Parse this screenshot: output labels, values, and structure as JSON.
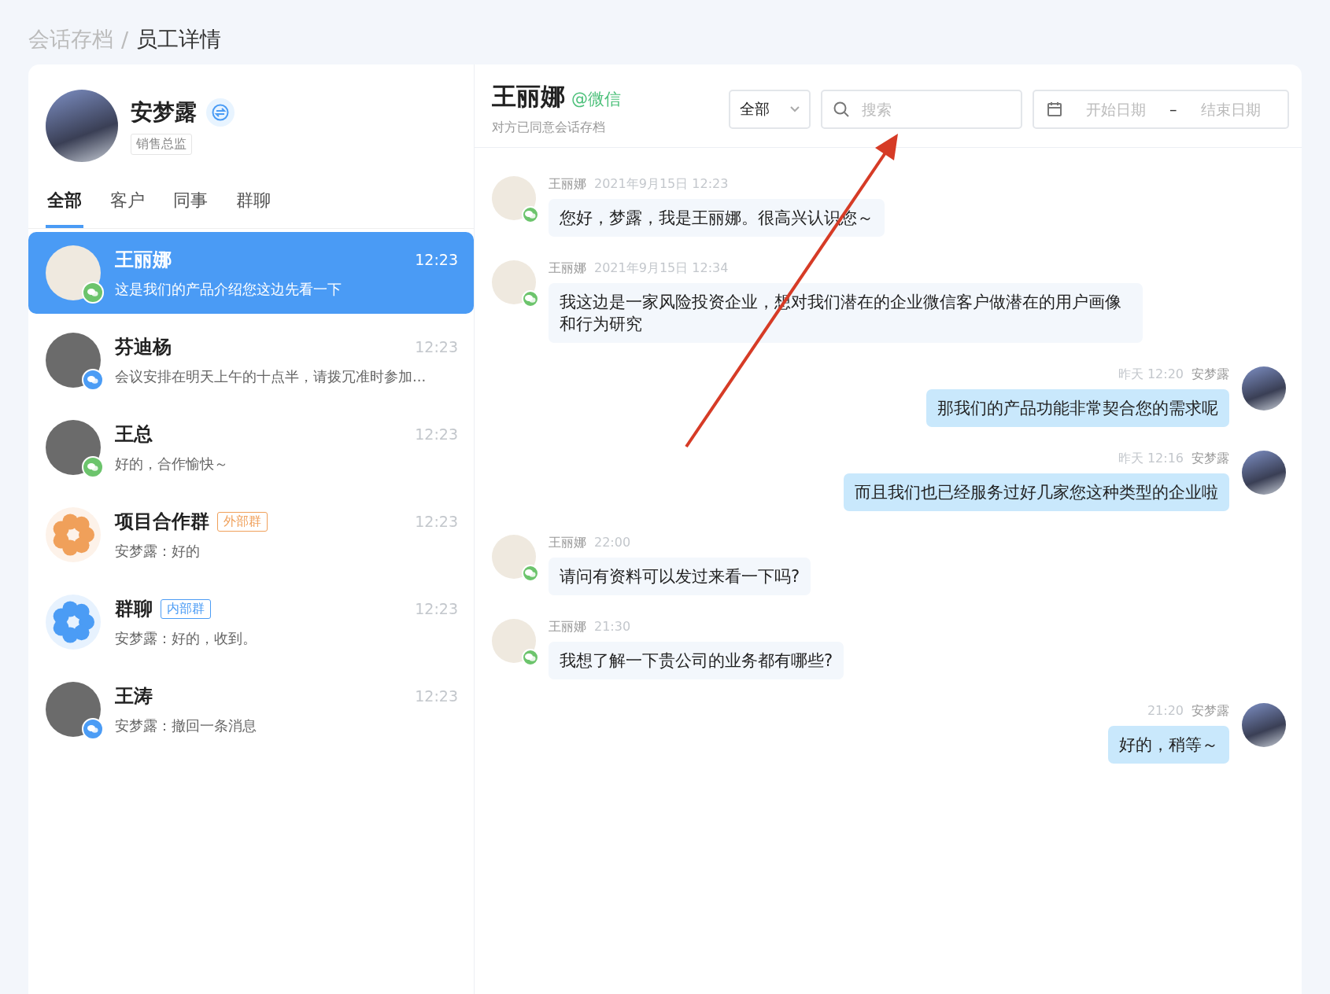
{
  "breadcrumb_separator": "/",
  "breadcrumb": [
    {
      "label": "会话存档",
      "current": false
    },
    {
      "label": "员工详情",
      "current": true
    }
  ],
  "employee": {
    "name": "安梦露",
    "role": "销售总监"
  },
  "tabs": [
    {
      "label": "全部",
      "selected": true
    },
    {
      "label": "客户",
      "selected": false
    },
    {
      "label": "同事",
      "selected": false
    },
    {
      "label": "群聊",
      "selected": false
    }
  ],
  "conversations": [
    {
      "name": "王丽娜",
      "preview": "这是我们的产品介绍您这边先看一下",
      "time": "12:23",
      "selected": true,
      "avatar": {
        "kind": "photo"
      },
      "badge": {
        "kind": "wechat"
      }
    },
    {
      "name": "芬迪杨",
      "preview": "会议安排在明天上午的十点半，请拨冗准时参加...",
      "time": "12:23",
      "selected": false,
      "avatar": {
        "kind": "photo"
      },
      "badge": {
        "kind": "work"
      }
    },
    {
      "name": "王总",
      "preview": "好的，合作愉快～",
      "time": "12:23",
      "selected": false,
      "avatar": {
        "kind": "photo"
      },
      "badge": {
        "kind": "wechat"
      }
    },
    {
      "name": "项目合作群",
      "tag": "外部群",
      "color": "#f0a05a",
      "preview": "安梦露：好的",
      "time": "12:23",
      "selected": false,
      "avatar": {
        "kind": "group"
      }
    },
    {
      "name": "群聊",
      "tag": "内部群",
      "color": "#4b9cf5",
      "preview": "安梦露：好的，收到。",
      "time": "12:23",
      "selected": false,
      "avatar": {
        "kind": "group"
      }
    },
    {
      "name": "王涛",
      "preview": "安梦露：撤回一条消息",
      "time": "12:23",
      "selected": false,
      "avatar": {
        "kind": "photo"
      },
      "badge": {
        "kind": "work"
      }
    }
  ],
  "chat": {
    "name": "王丽娜",
    "source": "@微信",
    "consent": "对方已同意会话存档",
    "filter": "全部",
    "search_placeholder": "搜索",
    "start_placeholder": "开始日期",
    "range_separator": "–",
    "end_placeholder": "结束日期"
  },
  "messages": [
    {
      "kind": "in",
      "sender": "王丽娜",
      "time": "2021年9月15日 12:23",
      "text": "您好，梦露，我是王丽娜。很高兴认识您～"
    },
    {
      "kind": "in",
      "sender": "王丽娜",
      "time": "2021年9月15日 12:34",
      "text": "我这边是一家风险投资企业，想对我们潜在的企业微信客户做潜在的用户画像和行为研究"
    },
    {
      "kind": "out",
      "sender": "安梦露",
      "time": "昨天 12:20",
      "text": "那我们的产品功能非常契合您的需求呢"
    },
    {
      "kind": "out",
      "sender": "安梦露",
      "time": "昨天 12:16",
      "text": "而且我们也已经服务过好几家您这种类型的企业啦"
    },
    {
      "kind": "in",
      "sender": "王丽娜",
      "time": "22:00",
      "text": "请问有资料可以发过来看一下吗?"
    },
    {
      "kind": "in",
      "sender": "王丽娜",
      "time": "21:30",
      "text": "我想了解一下贵公司的业务都有哪些?"
    },
    {
      "kind": "out",
      "sender": "安梦露",
      "time": "21:20",
      "text": "好的，稍等～"
    }
  ]
}
